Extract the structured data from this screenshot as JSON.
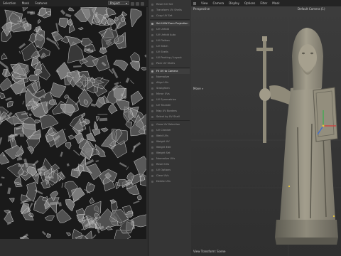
{
  "uv_editor": {
    "menu": [
      "Selection",
      "Mask",
      "Features"
    ],
    "uv_set_select": "Project",
    "tool_icons": [
      "grid-icon",
      "snap-icon",
      "view-icon"
    ]
  },
  "tool_panel": {
    "items": [
      {
        "label": "Reset UV Set",
        "icon": "reset-icon",
        "highlight": false
      },
      {
        "label": "Transform UV Shells",
        "icon": "transform-icon",
        "highlight": false
      },
      {
        "label": "Copy UV Set",
        "icon": "copy-icon",
        "highlight": false
      },
      {
        "label": "Set UVW From Projection",
        "icon": "projection-icon",
        "highlight": true
      },
      {
        "label": "UV Unfold",
        "icon": "unfold-icon",
        "highlight": false
      },
      {
        "label": "UV Unfold Auto",
        "icon": "unfold-auto-icon",
        "highlight": false
      },
      {
        "label": "UV Flatten",
        "icon": "flatten-icon",
        "highlight": false
      },
      {
        "label": "UV Stitch",
        "icon": "stitch-icon",
        "highlight": false
      },
      {
        "label": "UV Shells",
        "icon": "shells-icon",
        "highlight": false
      },
      {
        "label": "UV Packing / Layout",
        "icon": "layout-icon",
        "highlight": false
      },
      {
        "label": "Pack UV Shells",
        "icon": "pack-icon",
        "highlight": false
      },
      {
        "label": "Fit UV to Camera",
        "icon": "camera-fit-icon",
        "highlight": true
      },
      {
        "label": "Normalize",
        "icon": "normalize-icon",
        "highlight": false
      },
      {
        "label": "Align UVs",
        "icon": "align-icon",
        "highlight": false
      },
      {
        "label": "Straighten",
        "icon": "straighten-icon",
        "highlight": false
      },
      {
        "label": "Mirror UVs",
        "icon": "mirror-icon",
        "highlight": false
      },
      {
        "label": "UV Symmetrize",
        "icon": "symmetrize-icon",
        "highlight": false
      },
      {
        "label": "UV Transfer",
        "icon": "transfer-icon",
        "highlight": false
      },
      {
        "label": "Map UV Borders",
        "icon": "borders-icon",
        "highlight": false
      },
      {
        "label": "Select by UV Shell",
        "icon": "select-shell-icon",
        "highlight": false
      },
      {
        "label": "Grow UV Selection",
        "icon": "grow-icon",
        "highlight": false
      },
      {
        "label": "UV Checker",
        "icon": "checker-icon",
        "highlight": false
      },
      {
        "label": "Weld UVs",
        "icon": "weld-icon",
        "highlight": false
      },
      {
        "label": "Weight UV",
        "icon": "weight-icon",
        "highlight": false
      },
      {
        "label": "Weight Edit",
        "icon": "weight-edit-icon",
        "highlight": false
      },
      {
        "label": "Weight Set",
        "icon": "weight-set-icon",
        "highlight": false
      },
      {
        "label": "Normalize UVs",
        "icon": "normalize-uv-icon",
        "highlight": false
      },
      {
        "label": "Reset UVs",
        "icon": "reset-uv-icon",
        "highlight": false
      },
      {
        "label": "UV Options",
        "icon": "options-icon",
        "highlight": false
      },
      {
        "label": "Clear UVs",
        "icon": "clear-icon",
        "highlight": false
      },
      {
        "label": "Delete UVs",
        "icon": "delete-icon",
        "highlight": false
      }
    ]
  },
  "viewport": {
    "menu": [
      "View",
      "Camera",
      "Display",
      "Options",
      "Filter",
      "Mask"
    ],
    "view_name": "Perspective",
    "camera_name": "Default Camera (1)",
    "hint": "Move »",
    "status": "View Transform: Scene"
  }
}
